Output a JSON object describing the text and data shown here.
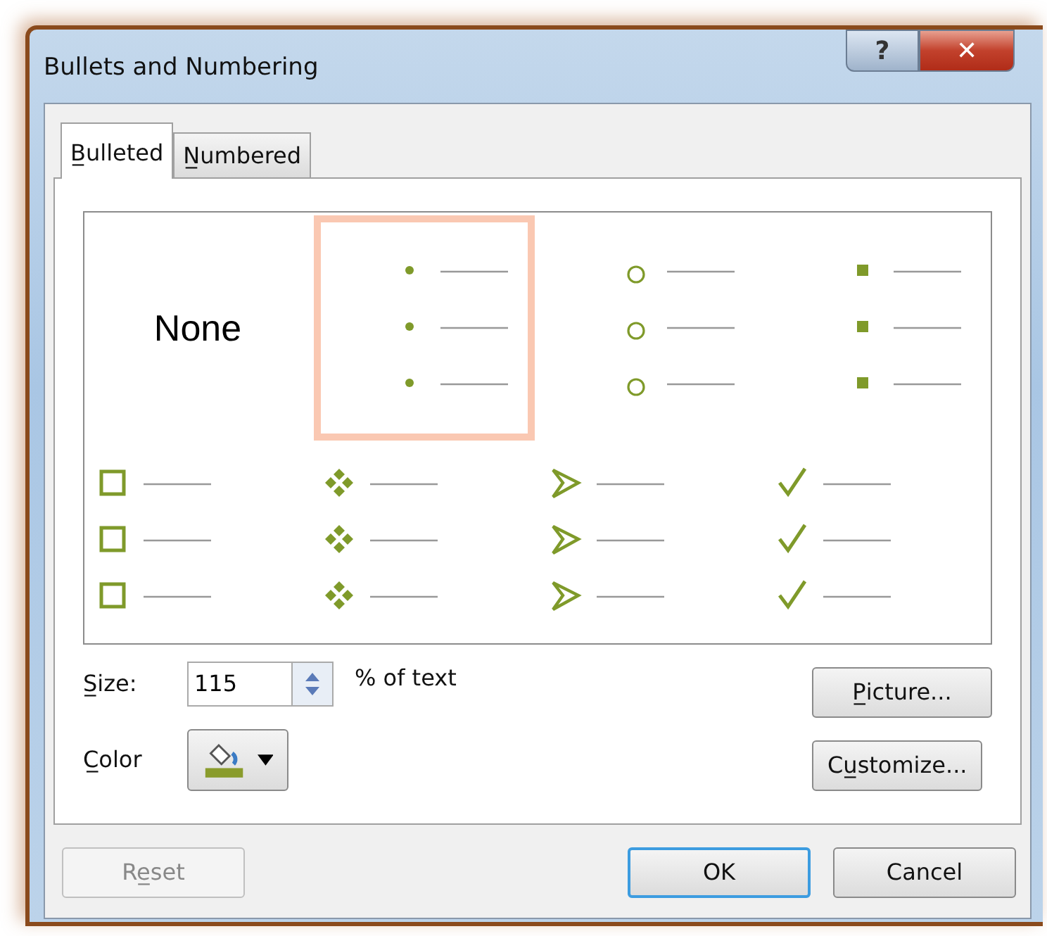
{
  "window": {
    "title": "Bullets and Numbering",
    "help": "?",
    "close": "✕"
  },
  "tabs": [
    {
      "label": "B̲ulleted",
      "selected": true
    },
    {
      "label": "N̲umbered",
      "selected": false
    }
  ],
  "bullet_styles": [
    {
      "kind": "none",
      "label": "None",
      "selected": false
    },
    {
      "kind": "dot",
      "selected": true
    },
    {
      "kind": "circle",
      "selected": false
    },
    {
      "kind": "square",
      "selected": false
    },
    {
      "kind": "box",
      "selected": false
    },
    {
      "kind": "diamonds",
      "selected": false
    },
    {
      "kind": "arrow",
      "selected": false
    },
    {
      "kind": "check",
      "selected": false
    }
  ],
  "size": {
    "label": "S̲ize:",
    "value": "115",
    "suffix": "% of text"
  },
  "color": {
    "label": "C̲olor"
  },
  "side_buttons": [
    {
      "label": "P̲icture..."
    },
    {
      "label": "Cu̲stomize..."
    }
  ],
  "footer_buttons": [
    {
      "label": "Re̲set",
      "disabled": true,
      "default": false
    },
    {
      "label": "OK",
      "disabled": false,
      "default": true
    },
    {
      "label": "Cancel",
      "disabled": false,
      "default": false
    }
  ]
}
